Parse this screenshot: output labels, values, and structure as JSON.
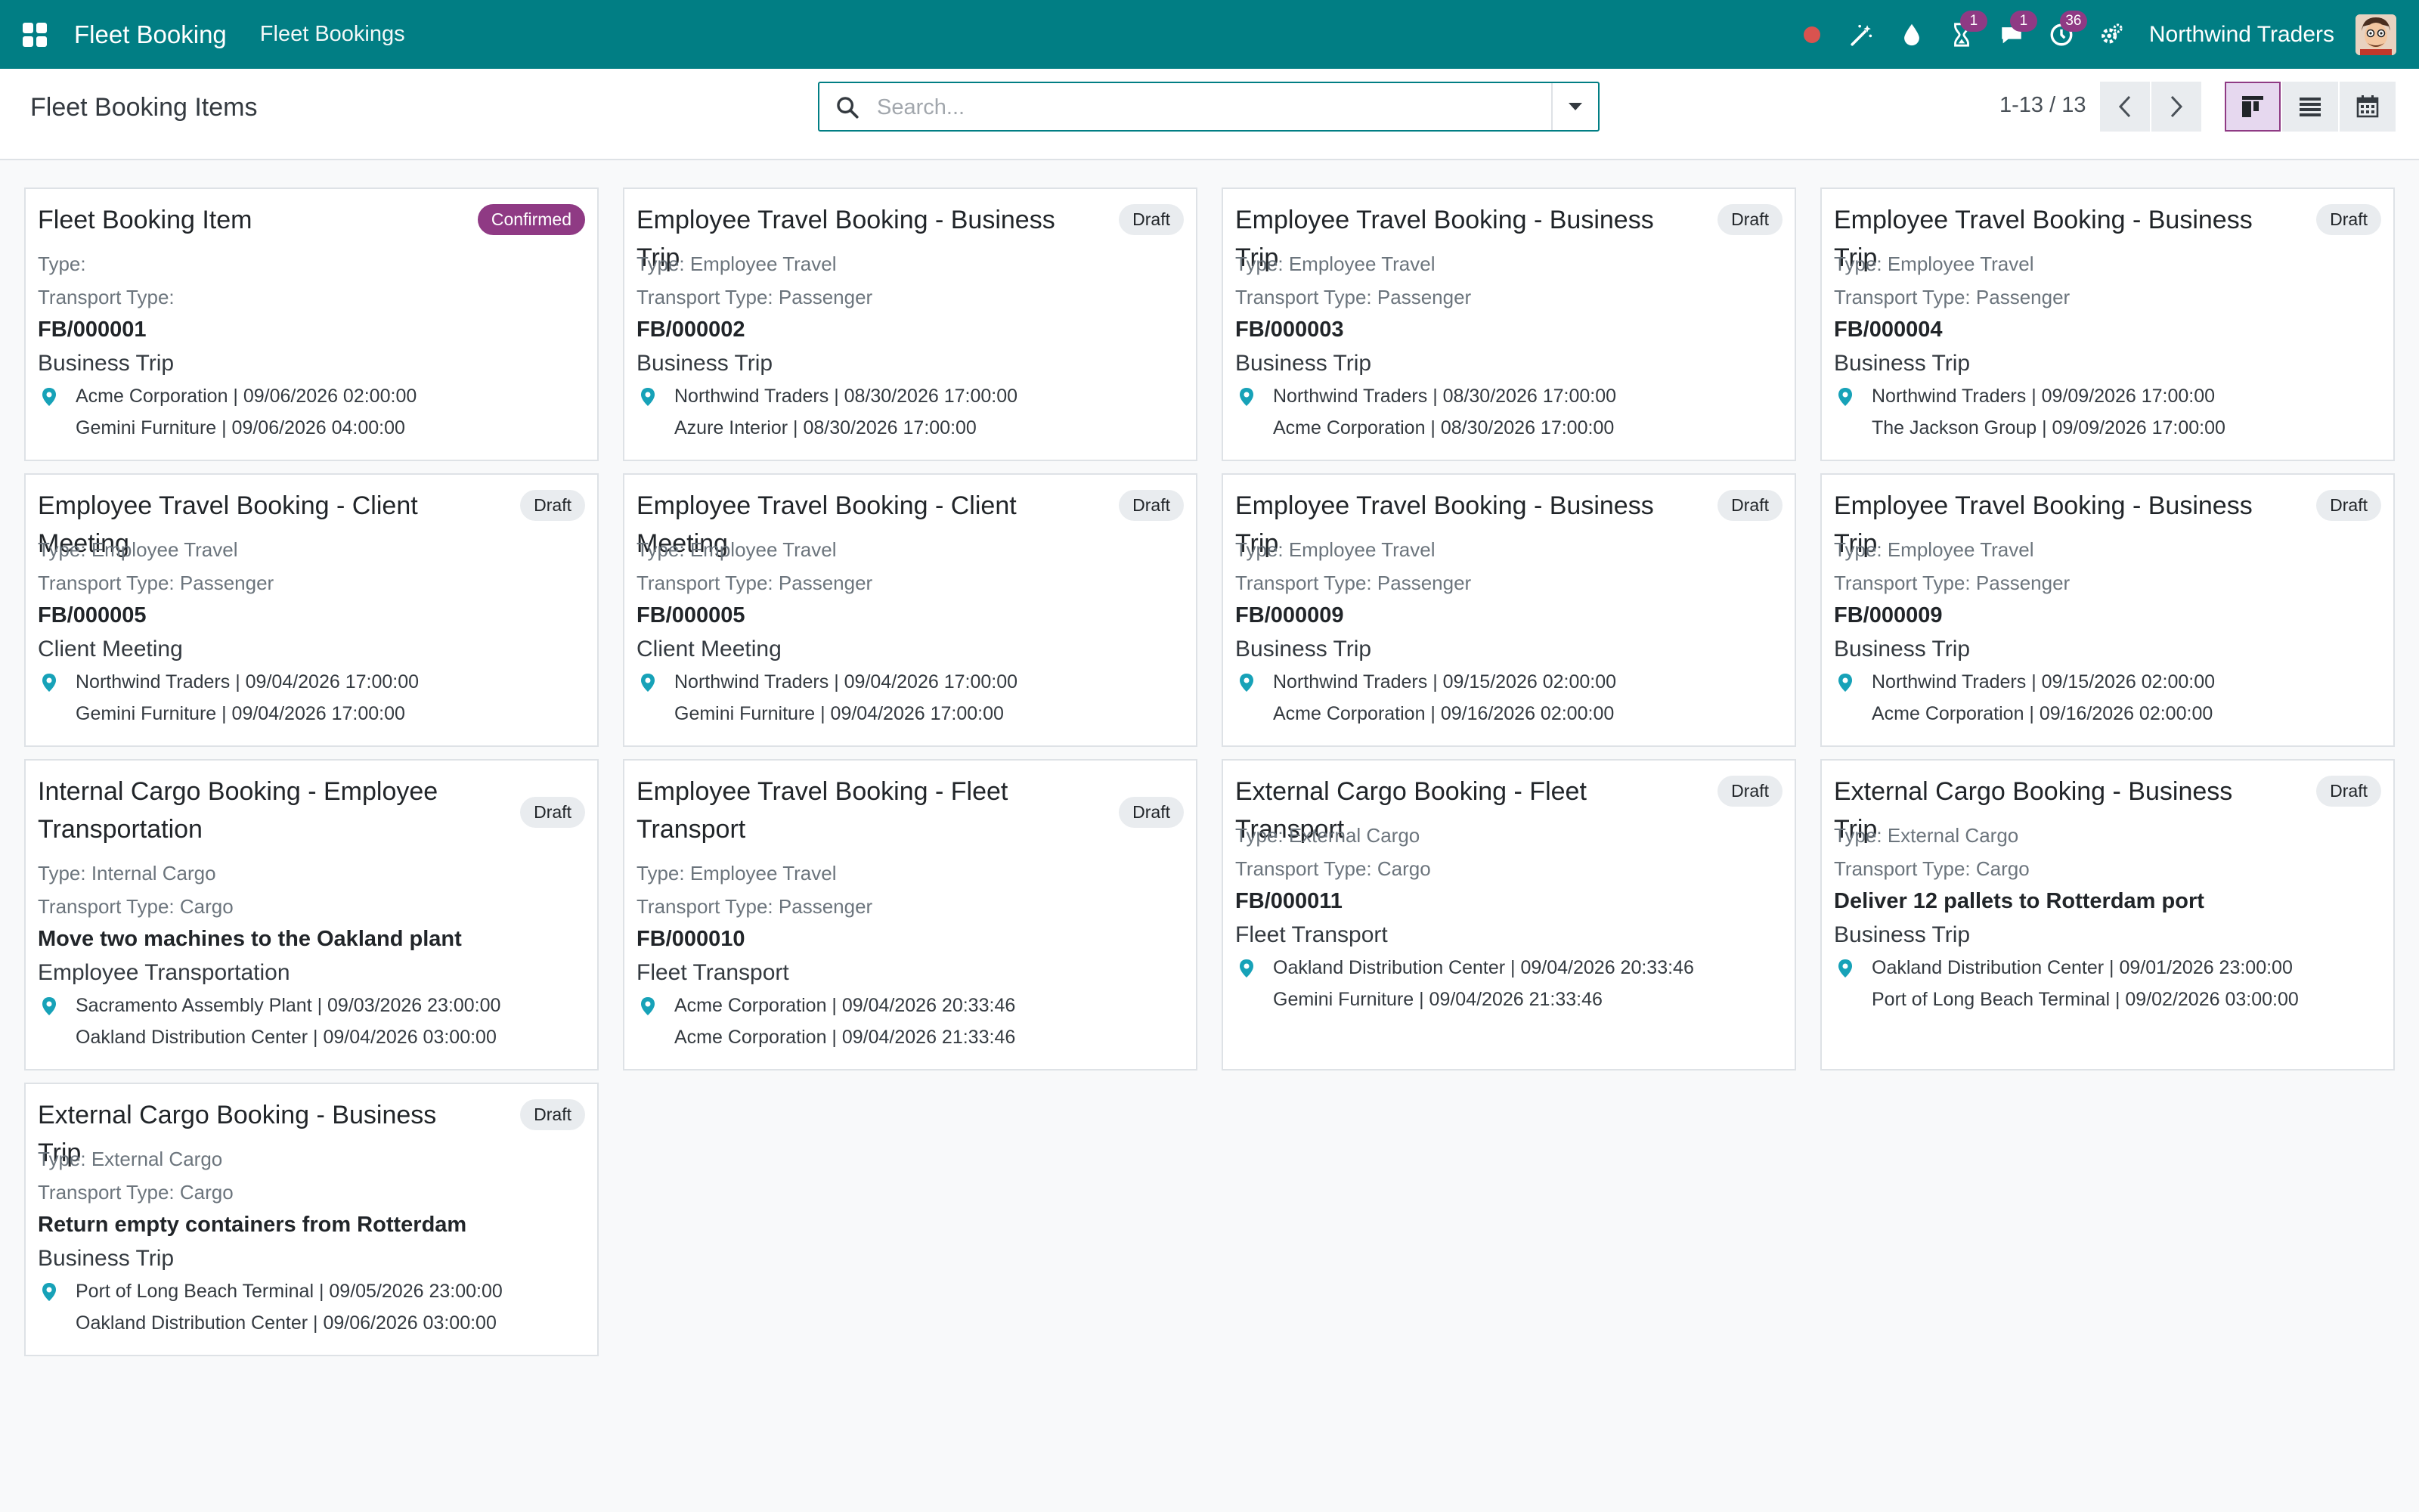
{
  "navbar": {
    "app_name": "Fleet Booking",
    "menu": "Fleet Bookings",
    "company": "Northwind Traders",
    "badges": {
      "activities": "1",
      "messages": "1",
      "updates": "36"
    },
    "colors": {
      "brand": "#017e84",
      "badge": "#8f3a84"
    },
    "icons": [
      "apps-grid-icon",
      "record-icon",
      "magic-wand-icon",
      "drop-icon",
      "hourglass-icon",
      "chat-icon",
      "clock-icon",
      "settings-icon"
    ]
  },
  "control": {
    "breadcrumb": "Fleet Booking Items",
    "search_placeholder": "Search...",
    "pager": "1-13 / 13",
    "views": [
      "kanban",
      "list",
      "calendar"
    ],
    "active_view": "kanban"
  },
  "labels": {
    "type": "Type:",
    "transport_type": "Transport Type:"
  },
  "cards": [
    {
      "title": "Fleet Booking Item",
      "state": "Confirmed",
      "type": "",
      "transport": "",
      "ref": "FB/000001",
      "purpose": "Business Trip",
      "from": "Acme Corporation | 09/06/2026 02:00:00",
      "to": "Gemini Furniture | 09/06/2026 04:00:00"
    },
    {
      "title": "Employee Travel Booking - Business Trip",
      "state": "Draft",
      "type": "Employee Travel",
      "transport": "Passenger",
      "ref": "FB/000002",
      "purpose": "Business Trip",
      "from": "Northwind Traders | 08/30/2026 17:00:00",
      "to": "Azure Interior | 08/30/2026 17:00:00"
    },
    {
      "title": "Employee Travel Booking - Business Trip",
      "state": "Draft",
      "type": "Employee Travel",
      "transport": "Passenger",
      "ref": "FB/000003",
      "purpose": "Business Trip",
      "from": "Northwind Traders | 08/30/2026 17:00:00",
      "to": "Acme Corporation | 08/30/2026 17:00:00"
    },
    {
      "title": "Employee Travel Booking - Business Trip",
      "state": "Draft",
      "type": "Employee Travel",
      "transport": "Passenger",
      "ref": "FB/000004",
      "purpose": "Business Trip",
      "from": "Northwind Traders | 09/09/2026 17:00:00",
      "to": "The Jackson Group | 09/09/2026 17:00:00"
    },
    {
      "title": "Employee Travel Booking - Client Meeting",
      "state": "Draft",
      "type": "Employee Travel",
      "transport": "Passenger",
      "ref": "FB/000005",
      "purpose": "Client Meeting",
      "from": "Northwind Traders | 09/04/2026 17:00:00",
      "to": "Gemini Furniture | 09/04/2026 17:00:00"
    },
    {
      "title": "Employee Travel Booking - Client Meeting",
      "state": "Draft",
      "type": "Employee Travel",
      "transport": "Passenger",
      "ref": "FB/000005",
      "purpose": "Client Meeting",
      "from": "Northwind Traders | 09/04/2026 17:00:00",
      "to": "Gemini Furniture | 09/04/2026 17:00:00"
    },
    {
      "title": "Employee Travel Booking - Business Trip",
      "state": "Draft",
      "type": "Employee Travel",
      "transport": "Passenger",
      "ref": "FB/000009",
      "purpose": "Business Trip",
      "from": "Northwind Traders | 09/15/2026 02:00:00",
      "to": "Acme Corporation | 09/16/2026 02:00:00"
    },
    {
      "title": "Employee Travel Booking - Business Trip",
      "state": "Draft",
      "type": "Employee Travel",
      "transport": "Passenger",
      "ref": "FB/000009",
      "purpose": "Business Trip",
      "from": "Northwind Traders | 09/15/2026 02:00:00",
      "to": "Acme Corporation | 09/16/2026 02:00:00"
    },
    {
      "title": "Internal Cargo Booking - Employee Transportation",
      "state": "Draft",
      "type": "Internal Cargo",
      "transport": "Cargo",
      "ref": "Move two machines to the Oakland plant",
      "purpose": "Employee Transportation",
      "from": "Sacramento Assembly Plant | 09/03/2026 23:00:00",
      "to": "Oakland Distribution Center | 09/04/2026 03:00:00"
    },
    {
      "title": "Employee Travel Booking - Fleet Transport",
      "state": "Draft",
      "type": "Employee Travel",
      "transport": "Passenger",
      "ref": "FB/000010",
      "purpose": "Fleet Transport",
      "from": "Acme Corporation | 09/04/2026 20:33:46",
      "to": "Acme Corporation | 09/04/2026 21:33:46"
    },
    {
      "title": "External Cargo Booking - Fleet Transport",
      "state": "Draft",
      "type": "External Cargo",
      "transport": "Cargo",
      "ref": "FB/000011",
      "purpose": "Fleet Transport",
      "from": "Oakland Distribution Center | 09/04/2026 20:33:46",
      "to": "Gemini Furniture | 09/04/2026 21:33:46"
    },
    {
      "title": "External Cargo Booking - Business Trip",
      "state": "Draft",
      "type": "External Cargo",
      "transport": "Cargo",
      "ref": "Deliver 12 pallets to Rotterdam port",
      "purpose": "Business Trip",
      "from": "Oakland Distribution Center | 09/01/2026 23:00:00",
      "to": "Port of Long Beach Terminal | 09/02/2026 03:00:00"
    },
    {
      "title": "External Cargo Booking - Business Trip",
      "state": "Draft",
      "type": "External Cargo",
      "transport": "Cargo",
      "ref": "Return empty containers from Rotterdam",
      "purpose": "Business Trip",
      "from": "Port of Long Beach Terminal | 09/05/2026 23:00:00",
      "to": "Oakland Distribution Center | 09/06/2026 03:00:00"
    }
  ]
}
